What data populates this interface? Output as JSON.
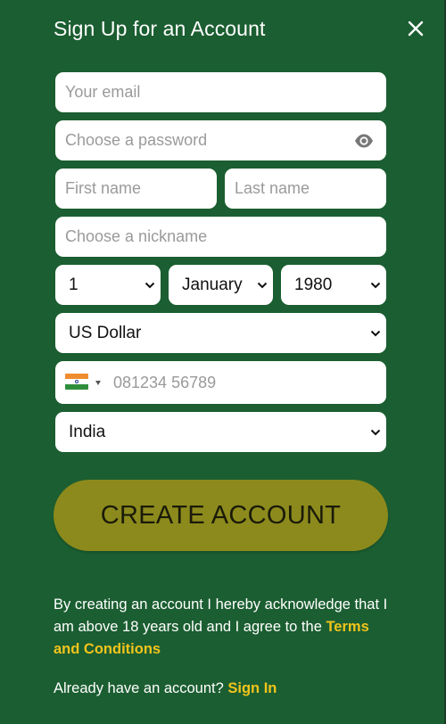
{
  "header": {
    "title": "Sign Up for an Account"
  },
  "form": {
    "email": {
      "placeholder": "Your email",
      "value": ""
    },
    "password": {
      "placeholder": "Choose a password",
      "value": ""
    },
    "first_name": {
      "placeholder": "First name",
      "value": ""
    },
    "last_name": {
      "placeholder": "Last name",
      "value": ""
    },
    "nickname": {
      "placeholder": "Choose a nickname",
      "value": ""
    },
    "dob": {
      "day": "1",
      "month": "January",
      "year": "1980"
    },
    "currency": "US Dollar",
    "phone": {
      "country_flag": "india-flag-icon",
      "placeholder": "081234 56789",
      "value": ""
    },
    "country": "India"
  },
  "cta": {
    "label": "CREATE ACCOUNT"
  },
  "legal": {
    "text": "By creating an account I hereby acknowledge that I am above 18 years old and I agree to the ",
    "terms_link": "Terms and Conditions"
  },
  "signin": {
    "prompt": "Already have an account? ",
    "link": "Sign In"
  },
  "colors": {
    "background": "#1b5e31",
    "cta": "#8c8a1c",
    "link": "#f2c41c",
    "field": "#ffffff"
  }
}
